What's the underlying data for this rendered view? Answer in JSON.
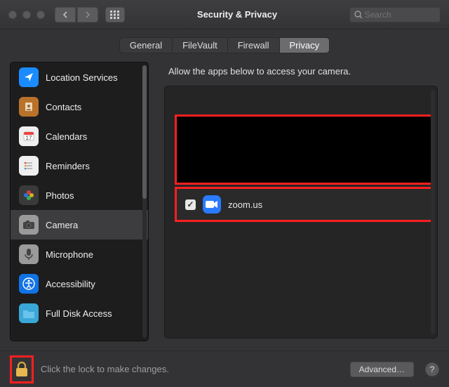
{
  "window": {
    "title": "Security & Privacy",
    "search_placeholder": "Search"
  },
  "tabs": [
    {
      "label": "General",
      "active": false
    },
    {
      "label": "FileVault",
      "active": false
    },
    {
      "label": "Firewall",
      "active": false
    },
    {
      "label": "Privacy",
      "active": true
    }
  ],
  "sidebar": {
    "items": [
      {
        "label": "Location Services",
        "icon": "location-icon",
        "color": "#1a8cff"
      },
      {
        "label": "Contacts",
        "icon": "contacts-icon",
        "color": "#b8722a"
      },
      {
        "label": "Calendars",
        "icon": "calendars-icon",
        "color": "#efefef"
      },
      {
        "label": "Reminders",
        "icon": "reminders-icon",
        "color": "#efefef"
      },
      {
        "label": "Photos",
        "icon": "photos-icon",
        "color": "#3a3a3a"
      },
      {
        "label": "Camera",
        "icon": "camera-icon",
        "color": "#9a9a9a",
        "selected": true
      },
      {
        "label": "Microphone",
        "icon": "microphone-icon",
        "color": "#9a9a9a"
      },
      {
        "label": "Accessibility",
        "icon": "accessibility-icon",
        "color": "#1173e6"
      },
      {
        "label": "Full Disk Access",
        "icon": "folder-icon",
        "color": "#3aa7d8"
      }
    ]
  },
  "main": {
    "instruction": "Allow the apps below to access your camera.",
    "apps": [
      {
        "name": "zoom.us",
        "checked": true
      }
    ]
  },
  "footer": {
    "lock_hint": "Click the lock to make changes.",
    "advanced": "Advanced…",
    "help": "?"
  }
}
